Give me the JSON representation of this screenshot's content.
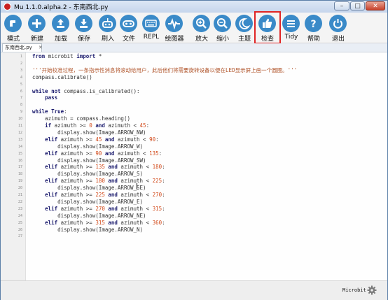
{
  "window": {
    "title": "Mu 1.1.0.alpha.2 - 东南西北.py",
    "controls": {
      "minimize": "–",
      "maximize": "□",
      "close": "✕"
    }
  },
  "toolbar": {
    "accent": "#3a8ac8",
    "active_highlight": "#e02424",
    "buttons": [
      {
        "id": "mode",
        "label": "模式",
        "icon": "mode-icon"
      },
      {
        "id": "new",
        "label": "新建",
        "icon": "plus-icon"
      },
      {
        "id": "load",
        "label": "加载",
        "icon": "upload-icon"
      },
      {
        "id": "save",
        "label": "保存",
        "icon": "download-icon"
      },
      {
        "id": "flash",
        "label": "刷入",
        "icon": "flash-icon"
      },
      {
        "id": "files",
        "label": "文件",
        "icon": "files-icon"
      },
      {
        "id": "repl",
        "label": "REPL",
        "icon": "keyboard-icon"
      },
      {
        "id": "plotter",
        "label": "绘图器",
        "icon": "plotter-icon"
      },
      {
        "id": "zoom-in",
        "label": "放大",
        "icon": "zoom-in-icon"
      },
      {
        "id": "zoom-out",
        "label": "缩小",
        "icon": "zoom-out-icon"
      },
      {
        "id": "theme",
        "label": "主题",
        "icon": "moon-icon"
      },
      {
        "id": "check",
        "label": "检查",
        "icon": "thumbs-up-icon",
        "active": true
      },
      {
        "id": "tidy",
        "label": "Tidy",
        "icon": "tidy-icon"
      },
      {
        "id": "help",
        "label": "帮助",
        "icon": "help-icon"
      },
      {
        "id": "quit",
        "label": "退出",
        "icon": "power-icon"
      }
    ]
  },
  "tab": {
    "name": "东南西北.py",
    "close": "✕"
  },
  "editor": {
    "lines": [
      "from microbit import *",
      "",
      "'''开始校准过程，一条指示性消息将滚动给用户，此后他们将需要旋转设备以便在LED显示屏上画一个圆圈。'''",
      "compass.calibrate()",
      "",
      "while not compass.is_calibrated():",
      "    pass",
      "",
      "while True:",
      "    azimuth = compass.heading()",
      "    if azimuth >= 0 and azimuth < 45:",
      "        display.show(Image.ARROW_NW)",
      "    elif azimuth >= 45 and azimuth < 90:",
      "        display.show(Image.ARROW_W)",
      "    elif azimuth >= 90 and azimuth < 135:",
      "        display.show(Image.ARROW_SW)",
      "    elif azimuth >= 135 and azimuth < 180:",
      "        display.show(Image.ARROW_S)",
      "    elif azimuth >= 180 and azimuth < 225:",
      "        display.show(Image.ARROW_SE)",
      "    elif azimuth >= 225 and azimuth < 270:",
      "        display.show(Image.ARROW_E)",
      "    elif azimuth >= 270 and azimuth < 315:",
      "        display.show(Image.ARROW_NE)",
      "    elif azimuth >= 315 and azimuth < 360:",
      "        display.show(Image.ARROW_N)",
      "",
      ""
    ],
    "line_numbers": [
      "1",
      "2",
      "3",
      "4",
      "5",
      "6",
      "7",
      "8",
      "9",
      "10",
      "11",
      "12",
      "13",
      "14",
      "15",
      "16",
      "17",
      "18",
      "19",
      "20",
      "21",
      "22",
      "23",
      "24",
      "25",
      "26",
      "27"
    ]
  },
  "status": {
    "board": "Microbit",
    "settings_icon": "gear-icon"
  }
}
